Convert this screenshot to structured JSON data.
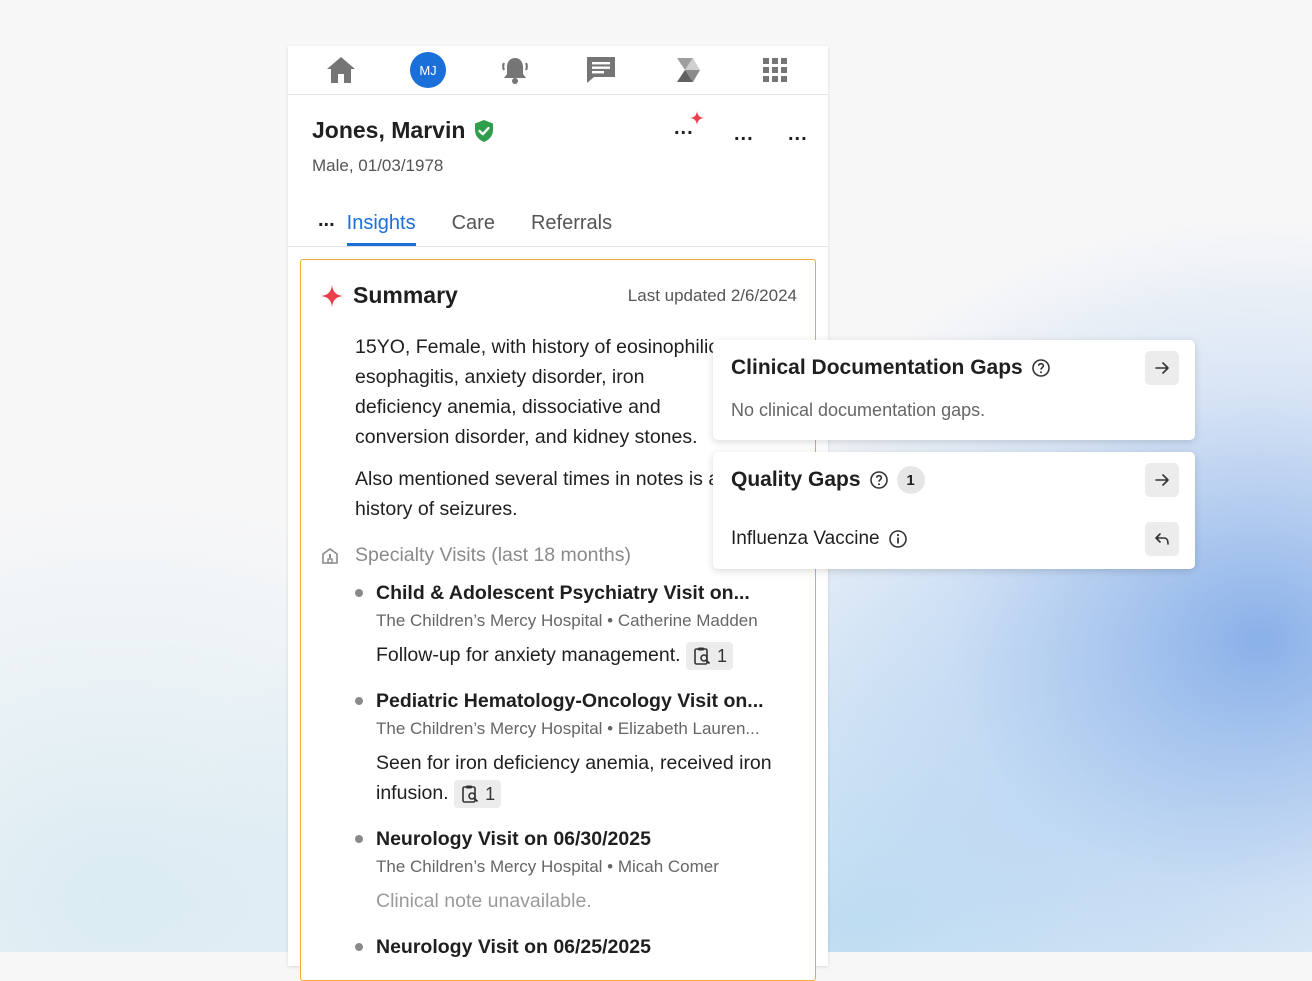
{
  "topnav": {
    "avatar_initials": "MJ",
    "icons": [
      "home-icon",
      "avatar",
      "bell-icon",
      "chat-icon",
      "prism-icon",
      "apps-grid-icon"
    ]
  },
  "patient": {
    "name": "Jones, Marvin",
    "demographics": "Male, 01/03/1978",
    "verified_color": "#2e9e4a"
  },
  "header_actions": {
    "more_label": "..."
  },
  "tabs": {
    "more_label": "...",
    "items": [
      {
        "label": "Insights",
        "active": true
      },
      {
        "label": "Care",
        "active": false
      },
      {
        "label": "Referrals",
        "active": false
      }
    ]
  },
  "summary": {
    "title": "Summary",
    "last_updated": "Last updated 2/6/2024",
    "paragraph1": "15YO, Female, with history of eosinophilic esophagitis, anxiety disorder, iron deficiency anemia, dissociative and conversion disorder, and kidney stones.",
    "paragraph2": "Also mentioned several times in notes is a history of seizures.",
    "specialty_heading": "Specialty Visits (last 18 months)",
    "visits": [
      {
        "title": "Child & Adolescent Psychiatry Visit on...",
        "meta": "The Children’s Mercy Hospital • Catherine Madden",
        "note": "Follow-up for anxiety management.",
        "chip_count": "1",
        "muted": false
      },
      {
        "title": "Pediatric Hematology-Oncology Visit on...",
        "meta": "The Children’s Mercy Hospital • Elizabeth Lauren...",
        "note": "Seen for iron deficiency anemia, received iron infusion.",
        "chip_count": "1",
        "muted": false
      },
      {
        "title": "Neurology Visit on 06/30/2025",
        "meta": "The Children’s Mercy Hospital • Micah Comer",
        "note": "Clinical note unavailable.",
        "chip_count": "",
        "muted": true
      },
      {
        "title": "Neurology Visit on 06/25/2025",
        "meta": "",
        "note": "",
        "chip_count": "",
        "muted": false
      }
    ]
  },
  "clinical_gaps": {
    "title": "Clinical Documentation Gaps",
    "empty_text": "No clinical documentation gaps."
  },
  "quality_gaps": {
    "title": "Quality Gaps",
    "count": "1",
    "item": "Influenza Vaccine"
  },
  "colors": {
    "accent": "#1a6fd8",
    "summary_border": "#f2a93b",
    "sparkle": "#e8404c"
  }
}
